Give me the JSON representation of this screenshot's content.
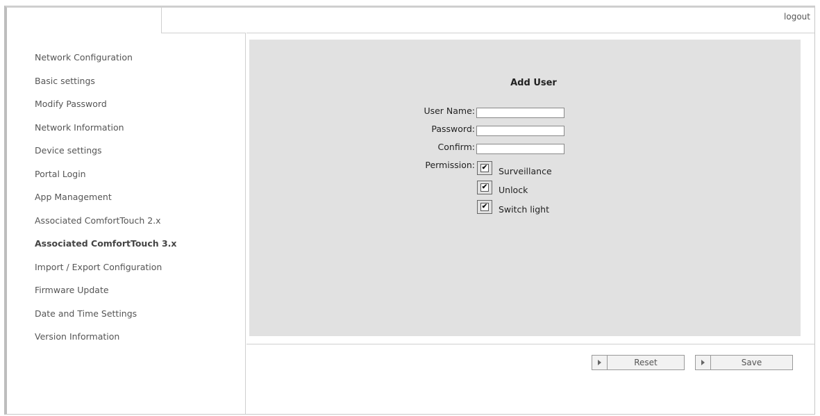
{
  "header": {
    "logout_label": "logout"
  },
  "sidebar": {
    "items": [
      {
        "label": "Network Configuration"
      },
      {
        "label": "Basic settings"
      },
      {
        "label": "Modify Password"
      },
      {
        "label": "Network Information"
      },
      {
        "label": "Device settings"
      },
      {
        "label": "Portal Login"
      },
      {
        "label": "App Management"
      },
      {
        "label": "Associated ComfortTouch 2.x"
      },
      {
        "label": "Associated ComfortTouch 3.x",
        "active": true
      },
      {
        "label": "Import / Export Configuration"
      },
      {
        "label": "Firmware Update"
      },
      {
        "label": "Date and Time Settings"
      },
      {
        "label": "Version Information"
      }
    ]
  },
  "form": {
    "title": "Add User",
    "username_label": "User Name:",
    "username_value": "",
    "password_label": "Password:",
    "password_value": "",
    "confirm_label": "Confirm:",
    "confirm_value": "",
    "permission_label": "Permission:",
    "permissions": [
      {
        "label": "Surveillance",
        "checked": true
      },
      {
        "label": "Unlock",
        "checked": true
      },
      {
        "label": "Switch light",
        "checked": true
      }
    ]
  },
  "actions": {
    "reset_label": "Reset",
    "save_label": "Save"
  },
  "icons": {
    "checkmark": "checkmark-icon",
    "button_arrow": "play-arrow-icon"
  },
  "colors": {
    "panel_bg": "#e1e1e1",
    "border": "#cfcfcf"
  }
}
